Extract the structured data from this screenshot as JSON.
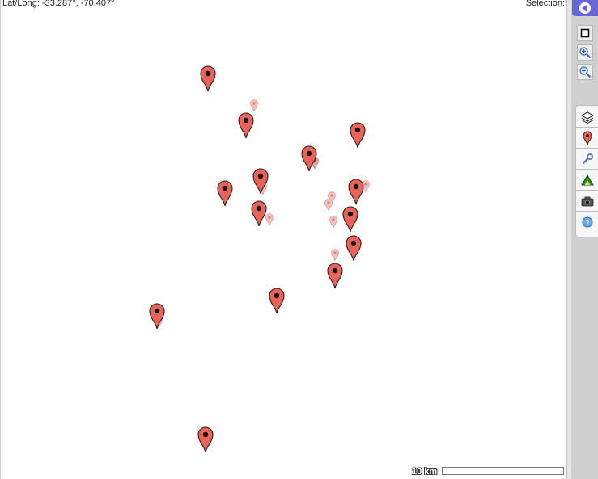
{
  "status": {
    "latlong": "Lat/Long: -33.287°, -70.407°",
    "selection": "Selection:"
  },
  "scale": {
    "label": "10 km"
  },
  "toolbar": {
    "toggle_icon": "collapse-arrow-icon",
    "tools": [
      "select-square-icon",
      "zoom-in-icon",
      "zoom-out-icon"
    ],
    "panel_tabs": [
      "layers-icon",
      "placemark-icon",
      "wrench-icon",
      "terrain-icon",
      "camera-icon",
      "help-icon"
    ]
  },
  "colors": {
    "pin": "#e8645a",
    "accent": "#6a66d6",
    "ghost": "#f2a9a3"
  }
}
